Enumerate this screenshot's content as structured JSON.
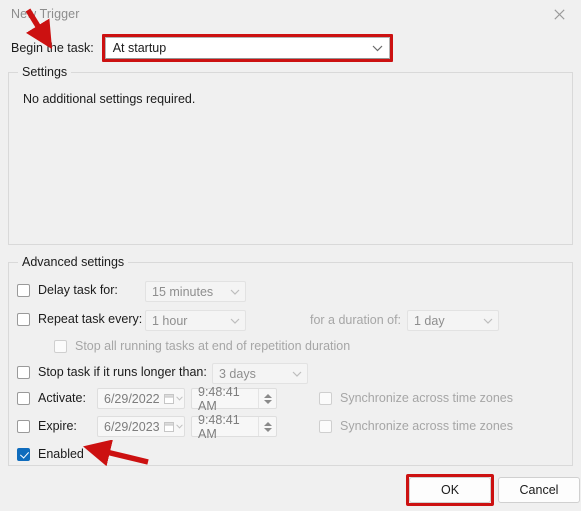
{
  "window": {
    "title": "New Trigger",
    "close_icon": "close-icon"
  },
  "begin_task": {
    "label": "Begin the task:",
    "selected": "At startup",
    "chevron_icon": "chevron-down-icon"
  },
  "settings": {
    "legend": "Settings",
    "note": "No additional settings required."
  },
  "advanced": {
    "legend": "Advanced settings",
    "delay": {
      "label": "Delay task for:",
      "value": "15 minutes",
      "checked": false
    },
    "repeat": {
      "label": "Repeat task every:",
      "value": "1 hour",
      "checked": false,
      "duration_label": "for a duration of:",
      "duration_value": "1 day"
    },
    "stop_all": {
      "label": "Stop all running tasks at end of repetition duration",
      "checked": false
    },
    "stop_longer": {
      "label": "Stop task if it runs longer than:",
      "value": "3 days",
      "checked": false
    },
    "activate": {
      "label": "Activate:",
      "date": "6/29/2022",
      "time": "9:48:41 AM",
      "sync_label": "Synchronize across time zones",
      "checked": false,
      "sync_checked": false
    },
    "expire": {
      "label": "Expire:",
      "date": "6/29/2023",
      "time": "9:48:41 AM",
      "sync_label": "Synchronize across time zones",
      "checked": false,
      "sync_checked": false
    },
    "enabled": {
      "label": "Enabled",
      "checked": true
    }
  },
  "buttons": {
    "ok": "OK",
    "cancel": "Cancel"
  },
  "annotations": {
    "arrow_color": "#cc1111",
    "highlight_color": "#cc1111",
    "arrow_title_target": "begin-task-dropdown",
    "arrow_enabled_target": "enabled-checkbox"
  }
}
